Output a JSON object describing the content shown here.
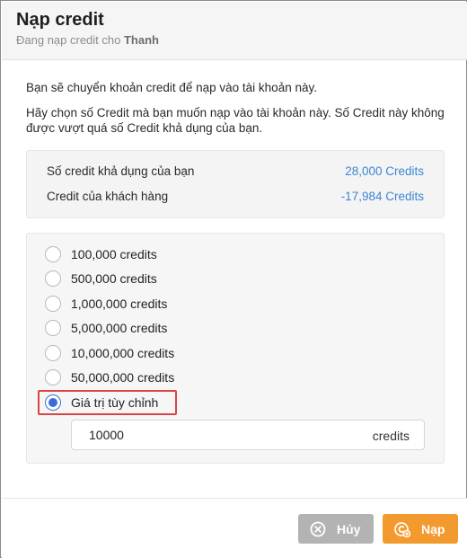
{
  "dialog": {
    "title": "Nạp credit",
    "subtitle_prefix": "Đang nạp credit cho ",
    "subtitle_name": "Thanh"
  },
  "description": {
    "line1": "Bạn sẽ chuyển khoản credit để nạp vào tài khoản này.",
    "line2": "Hãy chọn số Credit mà bạn muốn nạp vào tài khoản này. Số Credit này không được vượt quá số Credit khả dụng của bạn."
  },
  "info": {
    "available_label": "Số credit khả dụng của bạn",
    "available_value": "28,000 Credits",
    "customer_label": "Credit của khách hàng",
    "customer_value": "-17,984 Credits"
  },
  "options": [
    {
      "label": "100,000 credits",
      "checked": false
    },
    {
      "label": "500,000 credits",
      "checked": false
    },
    {
      "label": "1,000,000 credits",
      "checked": false
    },
    {
      "label": "5,000,000 credits",
      "checked": false
    },
    {
      "label": "10,000,000 credits",
      "checked": false
    },
    {
      "label": "50,000,000 credits",
      "checked": false
    },
    {
      "label": "Giá trị tùy chỉnh",
      "checked": true
    }
  ],
  "custom": {
    "value": "10000",
    "unit": "credits"
  },
  "buttons": {
    "cancel_label": "Hủy",
    "topup_label": "Nạp"
  },
  "colors": {
    "link_blue": "#3a86d4",
    "radio_blue": "#3a6fd8",
    "highlight_red": "#d94545",
    "cancel_gray": "#b3b3b3",
    "topup_orange": "#f39a2e"
  },
  "icons": {
    "cancel": "x-circle-icon",
    "topup": "credit-plus-icon"
  }
}
